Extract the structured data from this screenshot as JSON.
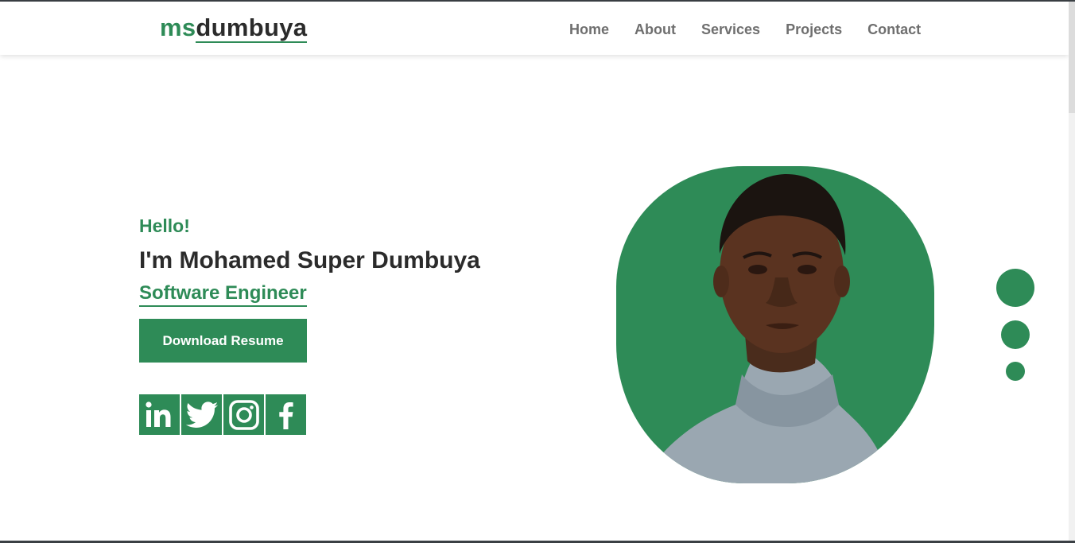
{
  "brand": {
    "prefix": "ms",
    "rest": "dumbuya"
  },
  "nav": [
    {
      "label": "Home"
    },
    {
      "label": "About"
    },
    {
      "label": "Services"
    },
    {
      "label": "Projects"
    },
    {
      "label": "Contact"
    }
  ],
  "hero": {
    "greeting": "Hello!",
    "name": "I'm Mohamed Super Dumbuya",
    "role": "Software Engineer",
    "cta_label": "Download Resume"
  },
  "socials": [
    {
      "icon": "linkedin-icon"
    },
    {
      "icon": "twitter-icon"
    },
    {
      "icon": "instagram-icon"
    },
    {
      "icon": "facebook-icon"
    }
  ],
  "colors": {
    "accent": "#2e8b57",
    "text": "#2b2b2b",
    "nav": "#6f6f6f"
  },
  "slider_dots": {
    "count": 3
  }
}
